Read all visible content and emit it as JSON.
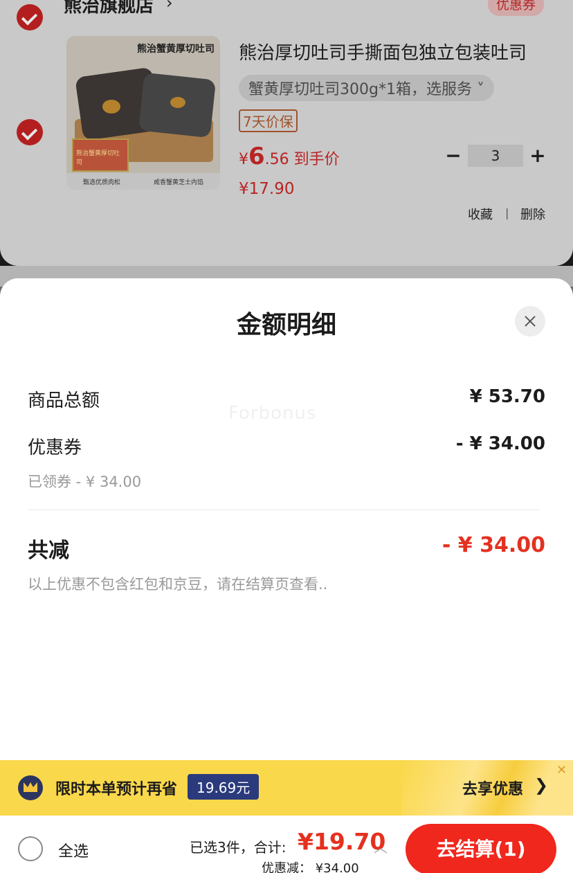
{
  "store": {
    "name": "熊治旗舰店",
    "arrow": "›",
    "coupon_label": "优惠券"
  },
  "product": {
    "image_title": "熊治蟹黄厚切吐司",
    "image_box_text": "熊治蟹黄厚切吐司",
    "image_foot_left": "甄选优质肉松",
    "image_foot_right": "咸香蟹黄芝士内馅",
    "title": "熊治厚切吐司手撕面包独立包装吐司",
    "spec": "蟹黄厚切吐司300g*1箱，选服务 ˅",
    "tag": "7天价保",
    "price_currency": "¥",
    "price_int": "6",
    "price_dec": ".56 到手价",
    "price_original": "¥17.90",
    "quantity": "3",
    "minus": "−",
    "plus": "+",
    "favorite": "收藏",
    "separator": "|",
    "delete": "删除"
  },
  "sheet": {
    "title": "金额明细",
    "watermark": "Forbonus",
    "goods_total_label": "商品总额",
    "goods_total_value": "¥ 53.70",
    "coupon_label": "优惠券",
    "coupon_value": "- ¥ 34.00",
    "coupon_note": "已领券 - ¥ 34.00",
    "reduced_label": "共减",
    "reduced_value": "- ¥ 34.00",
    "footnote": "以上优惠不包含红包和京豆，请在结算页查看.."
  },
  "promo": {
    "text": "限时本单预计再省",
    "badge": "19.69元",
    "link": "去享优惠",
    "arrow": "❯",
    "close": "✕"
  },
  "bottom": {
    "select_all": "全选",
    "summary_label": "已选3件，合计:",
    "summary_value": "¥19.70",
    "caret": "︿",
    "discount": "优惠减： ¥34.00",
    "checkout": "去结算(1)"
  },
  "colors": {
    "accent": "#f0271d",
    "price_red": "#e4311f",
    "promo_yellow": "#fad84b",
    "badge_navy": "#2a3a7c"
  }
}
